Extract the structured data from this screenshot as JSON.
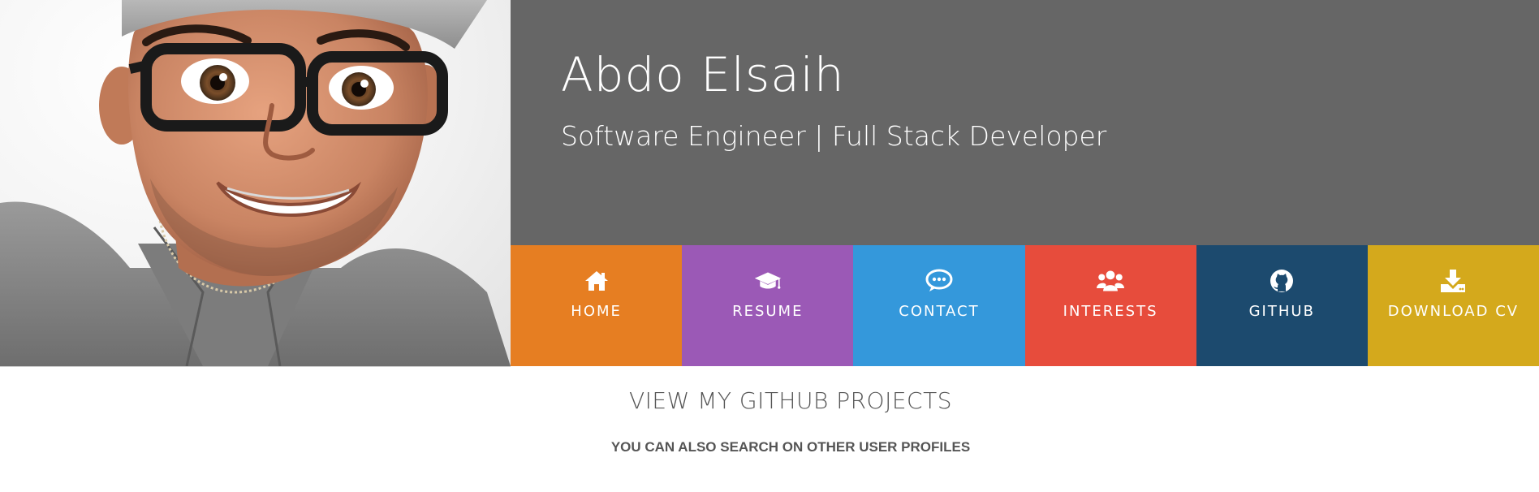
{
  "header": {
    "name": "Abdo Elsaih",
    "role": "Software Engineer | Full Stack Developer"
  },
  "nav": {
    "items": [
      {
        "label": "HOME",
        "icon": "home-icon",
        "color": "#E67E22"
      },
      {
        "label": "RESUME",
        "icon": "graduation-cap-icon",
        "color": "#9B59B6"
      },
      {
        "label": "CONTACT",
        "icon": "chat-icon",
        "color": "#3498DB"
      },
      {
        "label": "INTERESTS",
        "icon": "users-icon",
        "color": "#E74C3C"
      },
      {
        "label": "GITHUB",
        "icon": "github-icon",
        "color": "#1C4A6E"
      },
      {
        "label": "DOWNLOAD CV",
        "icon": "download-icon",
        "color": "#D4A91C"
      }
    ]
  },
  "section": {
    "title": "VIEW MY GITHUB PROJECTS",
    "subtitle": "YOU CAN ALSO SEARCH ON OTHER USER PROFILES"
  },
  "colors": {
    "title_panel_bg": "#666666",
    "text_muted": "#555555"
  }
}
